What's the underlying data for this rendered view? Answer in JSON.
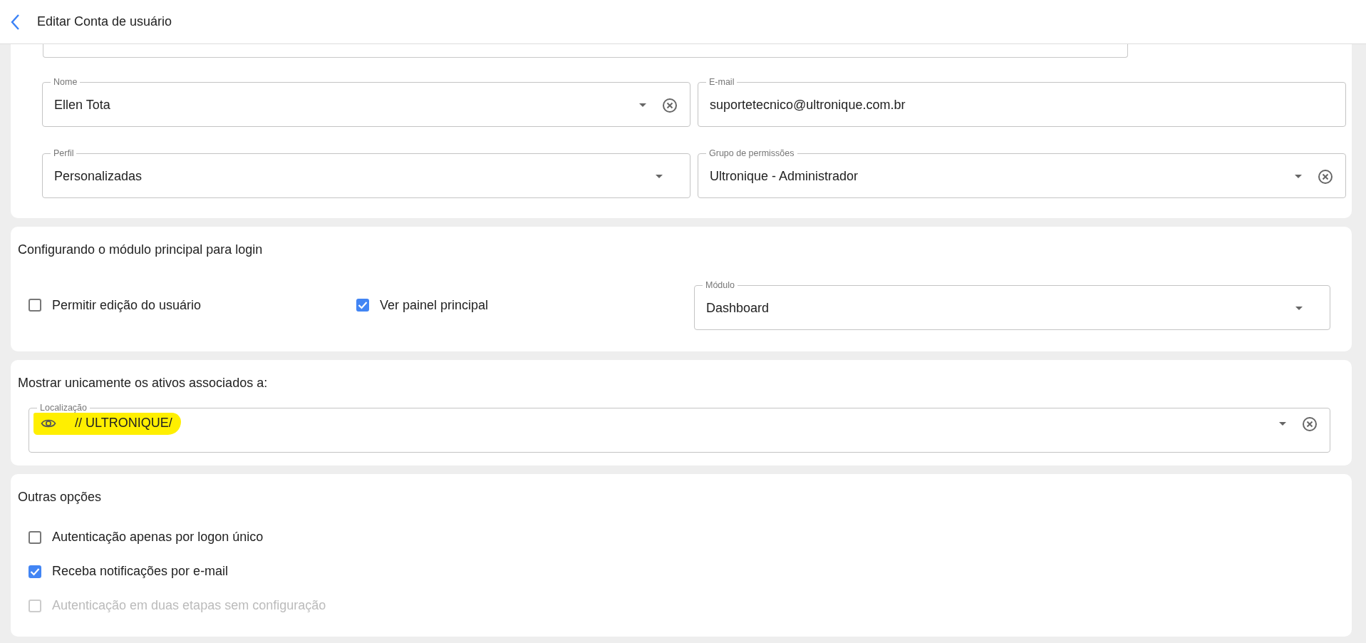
{
  "header": {
    "title": "Editar Conta de usuário"
  },
  "account": {
    "fields": [
      {
        "label": "Nome",
        "value": "Ellen Tota",
        "dropdown": true,
        "clearable": true
      },
      {
        "label": "E-mail",
        "value": "suportetecnico@ultronique.com.br",
        "dropdown": false,
        "clearable": false
      },
      {
        "label": "Perfil",
        "value": "Personalizadas",
        "dropdown": true,
        "clearable": false
      },
      {
        "label": "Grupo de permissões",
        "value": "Ultronique - Administrador",
        "dropdown": true,
        "clearable": true
      }
    ]
  },
  "login_module": {
    "title": "Configurando o módulo principal para login",
    "options": [
      {
        "label": "Permitir edição do usuário",
        "checked": false,
        "disabled": false
      },
      {
        "label": "Ver painel principal",
        "checked": true,
        "disabled": false
      }
    ],
    "module_field": {
      "label": "Módulo",
      "value": "Dashboard",
      "dropdown": true,
      "clearable": false
    }
  },
  "assets": {
    "title": "Mostrar unicamente os ativos associados a:",
    "location_field": {
      "label": "Localização",
      "value": "// ULTRONIQUE/",
      "highlighted": true,
      "dropdown": true,
      "clearable": true
    }
  },
  "other_options": {
    "title": "Outras opções",
    "options": [
      {
        "label": "Autenticação apenas por logon único",
        "checked": false,
        "disabled": false
      },
      {
        "label": "Receba notificações por e-mail",
        "checked": true,
        "disabled": false
      },
      {
        "label": "Autenticação em duas etapas sem configuração",
        "checked": false,
        "disabled": true
      }
    ]
  }
}
